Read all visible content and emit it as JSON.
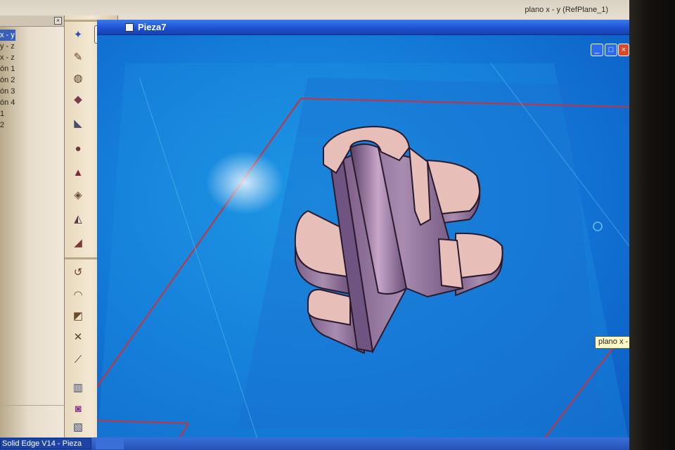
{
  "window": {
    "title": "Pieza7",
    "plane_readout": "plano x - y (RefPlane_1)"
  },
  "tree": {
    "items": [
      "x - y",
      "y - z",
      "x - z",
      "ón 1",
      "ón 2",
      "ón 3",
      "ón 4",
      "1",
      "2"
    ],
    "selected_index": 0
  },
  "viewport": {
    "plane_tag": "plano x -"
  },
  "taskbar": {
    "app_button": "Solid Edge V14 - Pieza"
  },
  "icons": {
    "toolbar": [
      "select-arrow-icon",
      "pin-icon",
      "sketch-icon",
      "revolve-icon",
      "extrude-icon",
      "cut-icon",
      "hole-icon",
      "round-icon",
      "chamfer-icon",
      "draft-icon",
      "thin-wall-icon",
      "rib-icon",
      "pattern-icon",
      "mirror-icon",
      "sweep-icon",
      "loft-icon",
      "helix-icon",
      "normal-icon",
      "plane-icon",
      "coordinate-icon"
    ]
  },
  "colors": {
    "viewport": "#1276d6",
    "plane_edge": "#c8323c",
    "title_bar": "#1c4fcf",
    "part": "#a47fa8",
    "part_face": "#e8bfb8"
  }
}
